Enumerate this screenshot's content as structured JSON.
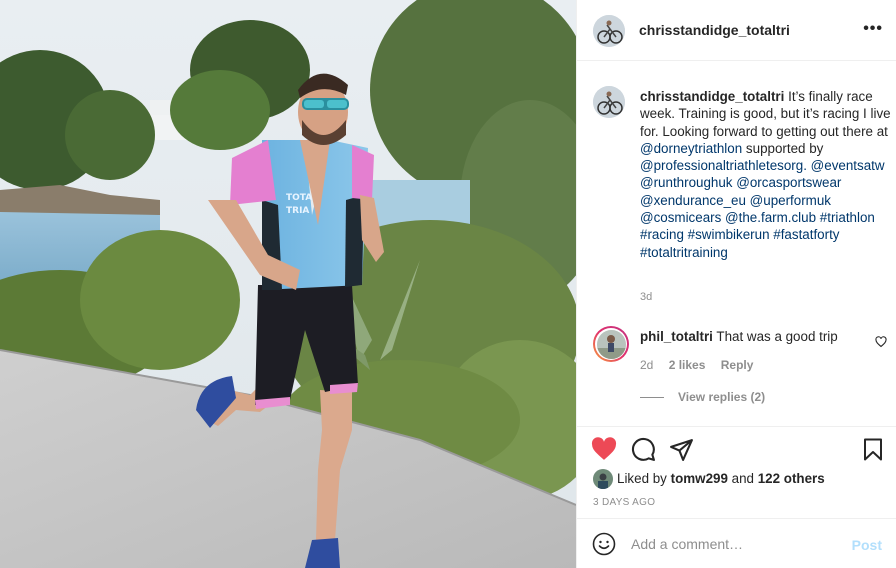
{
  "post": {
    "author": "chrisstandidge_totaltri",
    "more_icon": "more-horizontal-icon",
    "caption": {
      "username": "chrisstandidge_totaltri",
      "text": "It’s finally race week. Training is good, but it’s racing I live for. Looking forward to getting out there at",
      "mention_dorney": "@dorneytriathlon",
      "supported_by": "supported by",
      "tags": [
        "@professionaltriathletesorg.",
        "@eventsatw",
        "@runthroughuk",
        "@orcasportswear",
        "@xendurance_eu",
        "@uperformuk",
        "@cosmicears",
        "@the.farm.club",
        "#triathlon",
        "#racing",
        "#swimbikerun",
        "#fastatforty",
        "#totaltritraining"
      ],
      "time": "3d"
    },
    "comment": {
      "username": "phil_totaltri",
      "text": "That was a good trip",
      "time": "2d",
      "likes": "2 likes",
      "reply": "Reply",
      "view_replies": "View replies (2)"
    },
    "actions": {
      "like_icon": "heart-filled-icon",
      "comment_icon": "comment-icon",
      "share_icon": "paper-plane-icon",
      "save_icon": "bookmark-icon",
      "like_color": "#ed4956"
    },
    "liked_by": {
      "prefix": "Liked by",
      "user": "tomw299",
      "and": "and",
      "others": "122 others"
    },
    "date": "3 DAYS AGO",
    "add_comment": {
      "placeholder": "Add a comment…",
      "post_label": "Post",
      "emoji_icon": "smiley-icon",
      "post_color": "#b2dffc"
    }
  }
}
